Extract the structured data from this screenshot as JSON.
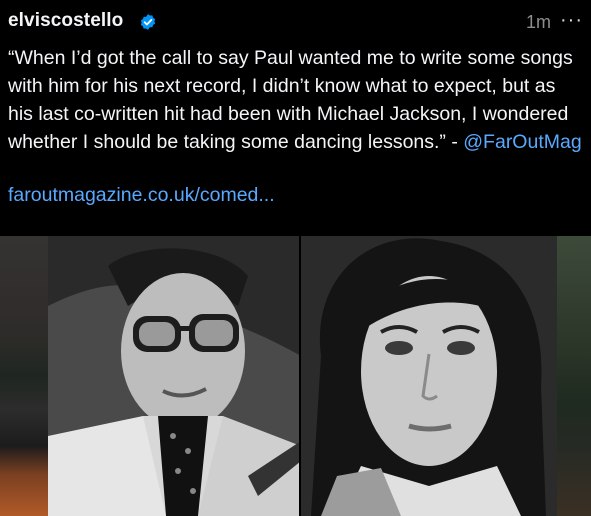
{
  "post": {
    "username": "elviscostello",
    "verified_icon": "verified-badge-icon",
    "time": "1m",
    "more_label": "···",
    "text_quote": "“When I’d got the call to say Paul wanted me to write some songs with him for his next record, I didn’t know what to expect, but as his last co-written hit had been with Michael Jackson, I wondered whether I should be taking some dancing lessons.” - ",
    "mention": "@FarOutMag",
    "link": "faroutmagazine.co.uk/comed..."
  },
  "colors": {
    "background": "#000000",
    "text": "#f3f5f7",
    "link": "#5aa9ff",
    "muted": "#8e8e8e",
    "verified": "#0095f6"
  }
}
